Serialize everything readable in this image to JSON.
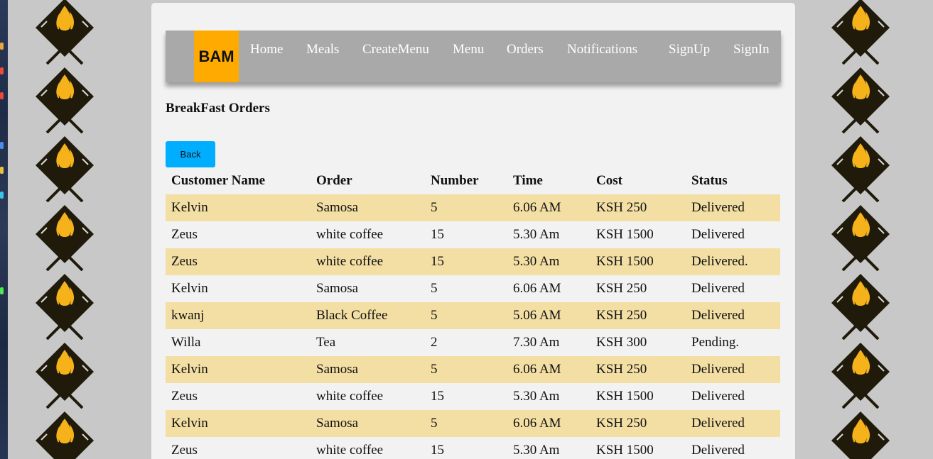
{
  "nav": {
    "brand": "BAM",
    "items": [
      {
        "label": "Home"
      },
      {
        "label": "Meals"
      },
      {
        "label": "CreateMenu"
      },
      {
        "label": "Menu"
      },
      {
        "label": "Orders"
      },
      {
        "label": "Notifications"
      },
      {
        "label": "SignUp"
      },
      {
        "label": "SignIn"
      }
    ]
  },
  "page": {
    "title": "BreakFast Orders",
    "back_label": "Back"
  },
  "table": {
    "headers": [
      "Customer Name",
      "Order",
      "Number",
      "Time",
      "Cost",
      "Status"
    ],
    "rows": [
      [
        "Kelvin",
        "Samosa",
        "5",
        "6.06 AM",
        "KSH 250",
        "Delivered"
      ],
      [
        "Zeus",
        "white coffee",
        "15",
        "5.30 Am",
        "KSH 1500",
        "Delivered"
      ],
      [
        "Zeus",
        "white coffee",
        "15",
        "5.30 Am",
        "KSH 1500",
        "Delivered."
      ],
      [
        "Kelvin",
        "Samosa",
        "5",
        "6.06 AM",
        "KSH 250",
        "Delivered"
      ],
      [
        "kwanj",
        "Black Coffee",
        "5",
        "5.06 AM",
        "KSH 250",
        "Delivered"
      ],
      [
        "Willa",
        "Tea",
        "2",
        "7.30 Am",
        "KSH 300",
        "Pending."
      ],
      [
        "Kelvin",
        "Samosa",
        "5",
        "6.06 AM",
        "KSH 250",
        "Delivered"
      ],
      [
        "Zeus",
        "white coffee",
        "15",
        "5.30 Am",
        "KSH 1500",
        "Delivered"
      ],
      [
        "Kelvin",
        "Samosa",
        "5",
        "6.06 AM",
        "KSH 250",
        "Delivered"
      ],
      [
        "Zeus",
        "white coffee",
        "15",
        "5.30 Am",
        "KSH 1500",
        "Delivered"
      ]
    ]
  },
  "colors": {
    "navbar": "#a9a9a9",
    "brand": "#ffaa00",
    "back_button": "#00aeff",
    "row_stripe": "#f3dfa4",
    "background_tile_dark": "#1f1a0a",
    "background_tile_flame": "#f5b21a"
  },
  "background_icon": "fork-knife-flame-icon"
}
